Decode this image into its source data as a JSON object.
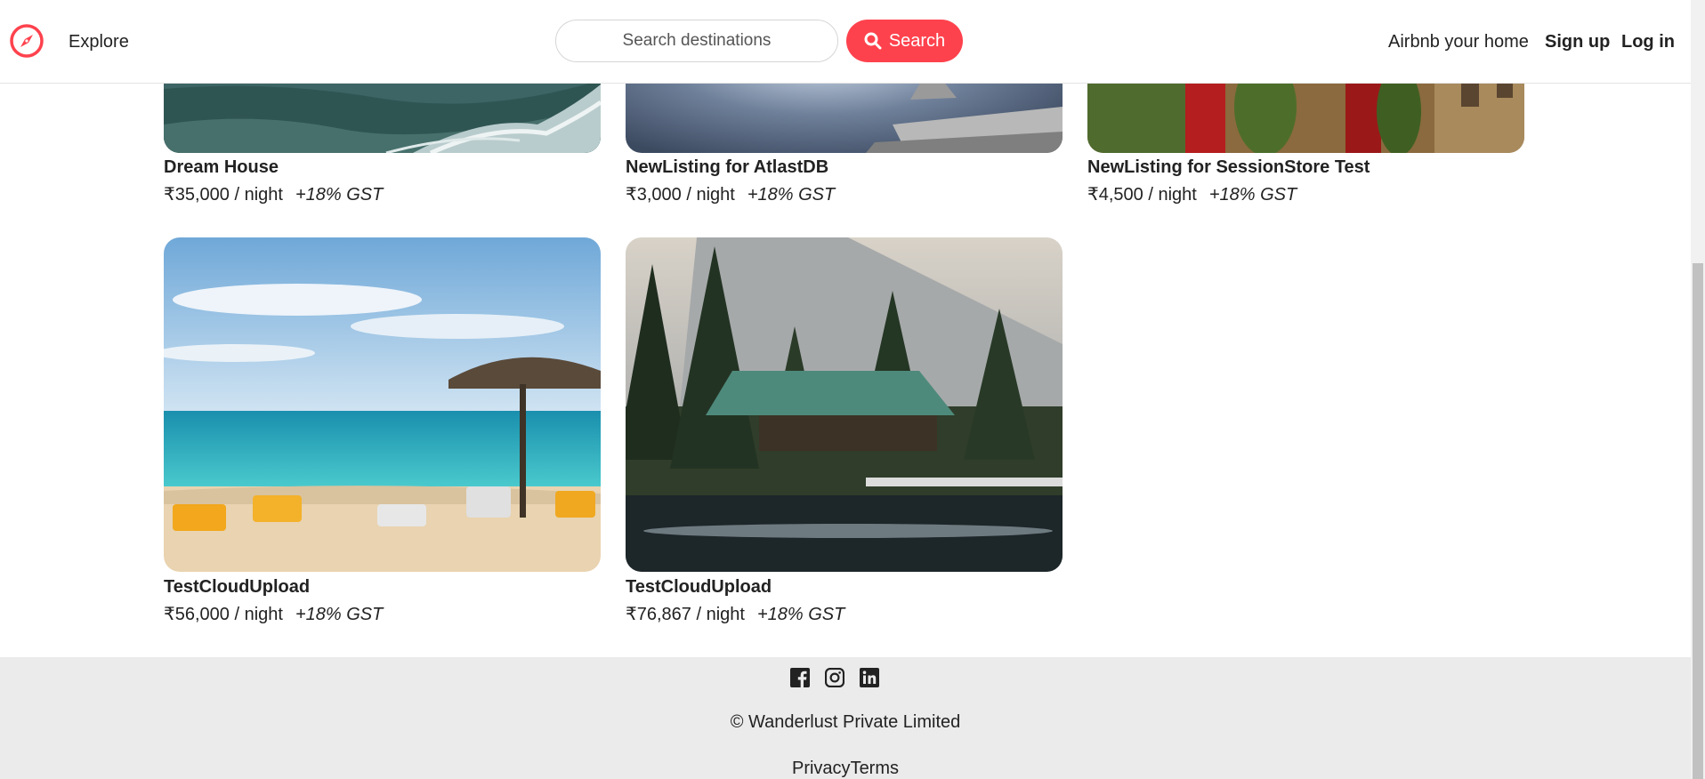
{
  "navbar": {
    "brand_icon": "compass-icon",
    "brand_color": "#fe424d",
    "explore_label": "Explore",
    "search_placeholder": "Search destinations",
    "search_value": "",
    "search_button_label": "Search",
    "search_button_color": "#fe424d",
    "host_label": "Airbnb your home",
    "signup_label": "Sign up",
    "login_label": "Log in"
  },
  "listings": [
    {
      "title": "Dream House",
      "price": "₹35,000 / night",
      "gst": "+18% GST",
      "image": "ocean-waves-aerial"
    },
    {
      "title": "NewListing for AtlastDB",
      "price": "₹3,000 / night",
      "gst": "+18% GST",
      "image": "statue-sky"
    },
    {
      "title": "NewListing for SessionStore Test",
      "price": "₹4,500 / night",
      "gst": "+18% GST",
      "image": "ivy-village-street"
    },
    {
      "title": "TestCloudUpload",
      "price": "₹56,000 / night",
      "gst": "+18% GST",
      "image": "beach-umbrella-loungers"
    },
    {
      "title": "TestCloudUpload",
      "price": "₹76,867 / night",
      "gst": "+18% GST",
      "image": "mountain-cabin-lake"
    }
  ],
  "footer": {
    "social_icons": [
      "facebook-icon",
      "instagram-icon",
      "linkedin-icon"
    ],
    "copyright": "© Wanderlust Private Limited",
    "privacy_label": "Privacy",
    "terms_label": "Terms"
  }
}
